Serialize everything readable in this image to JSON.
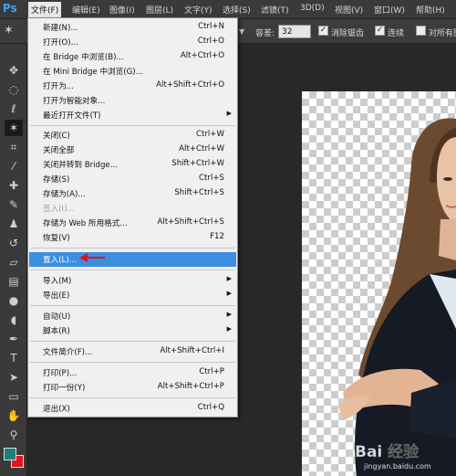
{
  "app": {
    "logo": "Ps"
  },
  "menubar": {
    "items": [
      {
        "label": "文件(F)",
        "open": true
      },
      {
        "label": "编辑(E)"
      },
      {
        "label": "图像(I)"
      },
      {
        "label": "图层(L)"
      },
      {
        "label": "文字(Y)"
      },
      {
        "label": "选择(S)"
      },
      {
        "label": "滤镜(T)"
      },
      {
        "label": "3D(D)"
      },
      {
        "label": "视图(V)"
      },
      {
        "label": "窗口(W)"
      },
      {
        "label": "帮助(H)"
      }
    ]
  },
  "options": {
    "tolerance_label": "容差:",
    "tolerance_value": "32",
    "anti_alias_label": "消除锯齿",
    "contiguous_label": "连续",
    "all_layers_label": "对所有图"
  },
  "file_menu": {
    "new": {
      "label": "新建(N)...",
      "shortcut": "Ctrl+N"
    },
    "open": {
      "label": "打开(O)...",
      "shortcut": "Ctrl+O"
    },
    "browse_bridge": {
      "label": "在 Bridge 中浏览(B)...",
      "shortcut": "Alt+Ctrl+O"
    },
    "browse_mini_bridge": {
      "label": "在 Mini Bridge 中浏览(G)..."
    },
    "open_as": {
      "label": "打开为...",
      "shortcut": "Alt+Shift+Ctrl+O"
    },
    "open_smart": {
      "label": "打开为智能对象..."
    },
    "recent": {
      "label": "最近打开文件(T)"
    },
    "close": {
      "label": "关闭(C)",
      "shortcut": "Ctrl+W"
    },
    "close_all": {
      "label": "关闭全部",
      "shortcut": "Alt+Ctrl+W"
    },
    "close_go_bridge": {
      "label": "关闭并转到 Bridge...",
      "shortcut": "Shift+Ctrl+W"
    },
    "save": {
      "label": "存储(S)",
      "shortcut": "Ctrl+S"
    },
    "save_as": {
      "label": "存储为(A)...",
      "shortcut": "Shift+Ctrl+S"
    },
    "check_in": {
      "label": "签入(I)..."
    },
    "save_web": {
      "label": "存储为 Web 所用格式...",
      "shortcut": "Alt+Shift+Ctrl+S"
    },
    "revert": {
      "label": "恢复(V)",
      "shortcut": "F12"
    },
    "place": {
      "label": "置入(L)..."
    },
    "import": {
      "label": "导入(M)"
    },
    "export": {
      "label": "导出(E)"
    },
    "automate": {
      "label": "自动(U)"
    },
    "scripts": {
      "label": "脚本(R)"
    },
    "file_info": {
      "label": "文件简介(F)...",
      "shortcut": "Alt+Shift+Ctrl+I"
    },
    "print": {
      "label": "打印(P)...",
      "shortcut": "Ctrl+P"
    },
    "print_one": {
      "label": "打印一份(Y)",
      "shortcut": "Alt+Shift+Ctrl+P"
    },
    "exit": {
      "label": "退出(X)",
      "shortcut": "Ctrl+Q"
    }
  },
  "watermark": {
    "text": "Bai 经验",
    "sub": "jingyan.baidu.com"
  },
  "colors": {
    "menu_highlight": "#3d8ee0",
    "foreground_swatch": "#1f7f79",
    "background_swatch": "#e0141c",
    "arrow": "#e0141c"
  }
}
